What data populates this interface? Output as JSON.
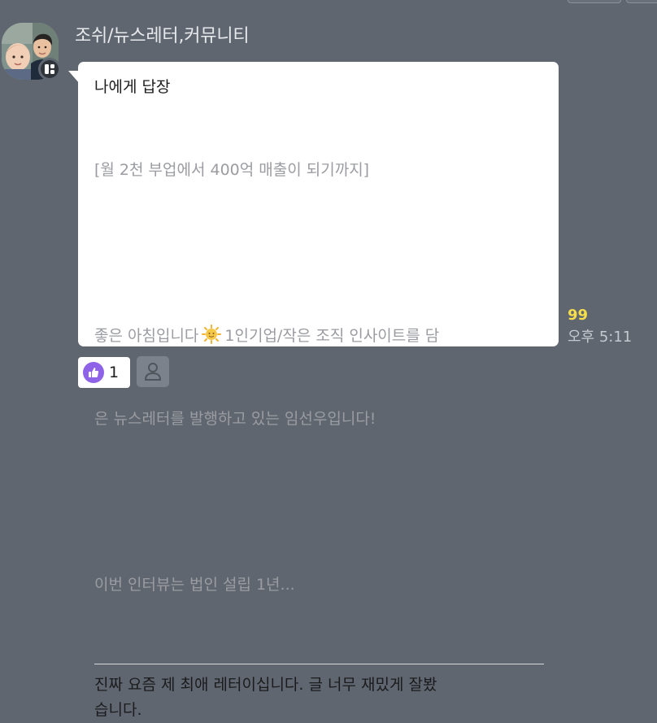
{
  "message": {
    "sender": "조쉬/뉴스레터,커뮤니티",
    "reply_title": "나에게 답장",
    "quote_lines": [
      "[월 2천 부업에서 400억 매출이 되기까지]",
      "",
      "좋은 아침입니다 {sun} 1인기업/작은 조직 인사이트를 담",
      "은 뉴스레터를 발행하고 있는 임선우입니다!",
      "",
      "이번 인터뷰는 법인 설립 1년..."
    ],
    "quote_line1": "[월 2천 부업에서 400억 매출이 되기까지]",
    "quote_line3_before": "좋은 아침입니다",
    "quote_line3_after": "1인기업/작은 조직 인사이트를 담",
    "quote_line4": "은 뉴스레터를 발행하고 있는 임선우입니다!",
    "quote_line6": "이번 인터뷰는 법인 설립 1년...",
    "reply_line1": "진짜 요즘 제 최애 레터이십니다. 글 너무 재밌게 잘봤",
    "reply_line2": "습니다.",
    "unread_count": "99",
    "time": "오후 5:11"
  },
  "reaction": {
    "icon": "thumbs-up-icon",
    "count": "1",
    "accent": "#8f63e8"
  },
  "colors": {
    "background": "#5f6670",
    "bubble": "#ffffff",
    "unread": "#f5dd4c",
    "quote": "#9b9ca1"
  }
}
